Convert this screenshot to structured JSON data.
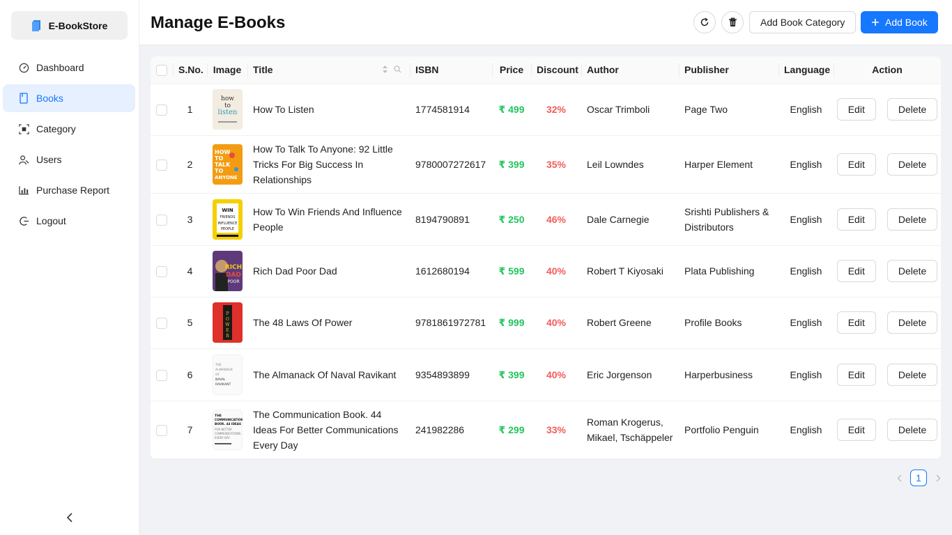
{
  "app": {
    "name": "E-BookStore"
  },
  "sidebar": {
    "items": [
      {
        "label": "Dashboard",
        "icon": "dashboard-icon"
      },
      {
        "label": "Books",
        "icon": "book-icon",
        "active": true
      },
      {
        "label": "Category",
        "icon": "category-icon"
      },
      {
        "label": "Users",
        "icon": "users-icon"
      },
      {
        "label": "Purchase Report",
        "icon": "bar-chart-icon"
      },
      {
        "label": "Logout",
        "icon": "logout-icon"
      }
    ]
  },
  "header": {
    "title": "Manage E-Books",
    "add_category_label": "Add Book Category",
    "add_book_label": "Add Book"
  },
  "table": {
    "columns": {
      "sno": "S.No.",
      "image": "Image",
      "title": "Title",
      "isbn": "ISBN",
      "price": "Price",
      "discount": "Discount",
      "author": "Author",
      "publisher": "Publisher",
      "language": "Language",
      "action": "Action"
    },
    "edit_label": "Edit",
    "delete_label": "Delete",
    "rows": [
      {
        "sno": "1",
        "title": "How To Listen",
        "isbn": "1774581914",
        "price": "₹ 499",
        "discount": "32%",
        "author": "Oscar Trimboli",
        "publisher": "Page Two",
        "language": "English"
      },
      {
        "sno": "2",
        "title": "How To Talk To Anyone: 92 Little Tricks For Big Success In Relationships",
        "isbn": "9780007272617",
        "price": "₹ 399",
        "discount": "35%",
        "author": "Leil Lowndes",
        "publisher": "Harper Element",
        "language": "English"
      },
      {
        "sno": "3",
        "title": "How To Win Friends And Influence People",
        "isbn": "8194790891",
        "price": "₹ 250",
        "discount": "46%",
        "author": "Dale Carnegie",
        "publisher": "Srishti Publishers & Distributors",
        "language": "English"
      },
      {
        "sno": "4",
        "title": "Rich Dad Poor Dad",
        "isbn": "1612680194",
        "price": "₹ 599",
        "discount": "40%",
        "author": "Robert T Kiyosaki",
        "publisher": "Plata Publishing",
        "language": "English"
      },
      {
        "sno": "5",
        "title": "The 48 Laws Of Power",
        "isbn": "9781861972781",
        "price": "₹ 999",
        "discount": "40%",
        "author": "Robert Greene",
        "publisher": "Profile Books",
        "language": "English"
      },
      {
        "sno": "6",
        "title": "The Almanack Of Naval Ravikant",
        "isbn": "9354893899",
        "price": "₹ 399",
        "discount": "40%",
        "author": "Eric Jorgenson",
        "publisher": "Harperbusiness",
        "language": "English"
      },
      {
        "sno": "7",
        "title": "The Communication Book. 44 Ideas For Better Communications Every Day",
        "isbn": "241982286",
        "price": "₹ 299",
        "discount": "33%",
        "author": "Roman Krogerus, Mikael, Tschäppeler",
        "publisher": "Portfolio Penguin",
        "language": "English"
      }
    ]
  },
  "pagination": {
    "current_page": "1"
  },
  "colors": {
    "primary": "#1677ff",
    "price": "#21c55d",
    "discount": "#f25c5c",
    "active_nav_bg": "#e6f0ff"
  }
}
